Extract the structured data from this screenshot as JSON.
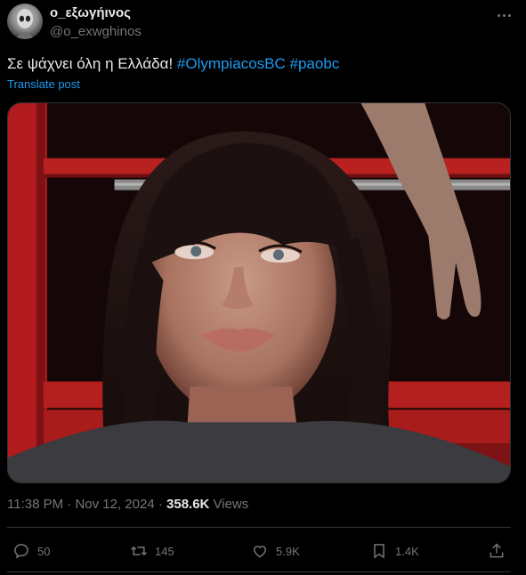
{
  "author": {
    "display_name": "ο_εξωγήινος",
    "handle": "@o_exwghinos"
  },
  "tweet": {
    "text": "Σε ψάχνει όλη η Ελλάδα! ",
    "hashtags": [
      "#OlympiacosBC",
      "#paobc"
    ],
    "translate_label": "Translate post"
  },
  "meta": {
    "time": "11:38 PM",
    "separator": " · ",
    "date": "Nov 12, 2024",
    "views_count": "358.6K",
    "views_label": " Views"
  },
  "actions": {
    "replies": "50",
    "reposts": "145",
    "likes": "5.9K",
    "bookmarks": "1.4K"
  },
  "colors": {
    "background": "#000000",
    "text": "#e7e9ea",
    "secondary": "#71767b",
    "link": "#1d9bf0",
    "border": "#2f3336"
  },
  "icons": [
    "more-icon",
    "reply-icon",
    "repost-icon",
    "like-icon",
    "bookmark-icon",
    "share-icon"
  ]
}
